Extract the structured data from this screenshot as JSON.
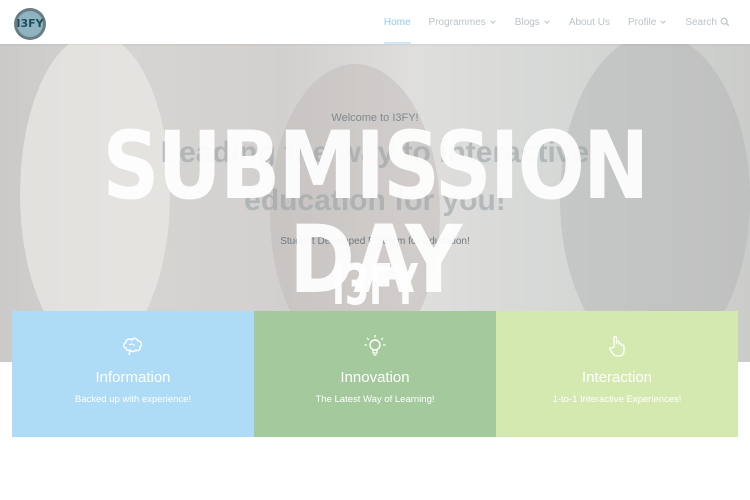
{
  "logo": {
    "text": "I3FY"
  },
  "nav": {
    "items": [
      {
        "label": "Home",
        "active": true,
        "dropdown": false
      },
      {
        "label": "Programmes",
        "active": false,
        "dropdown": true
      },
      {
        "label": "Blogs",
        "active": false,
        "dropdown": true
      },
      {
        "label": "About Us",
        "active": false,
        "dropdown": false
      },
      {
        "label": "Profile",
        "active": false,
        "dropdown": true
      }
    ],
    "search_label": "Search"
  },
  "hero": {
    "welcome": "Welcome to I3FY!",
    "headline_lines": [
      "Leading the way to interactive",
      "education for you!"
    ],
    "subtext": "Student Developed Platform for Education!",
    "overlay_title": "SUBMISSION DAY",
    "overlay_subtitle": "I3FY"
  },
  "features": [
    {
      "icon": "brain-icon",
      "title": "Information",
      "description": "Backed up with experience!",
      "color": "#aedbf6"
    },
    {
      "icon": "lightbulb-icon",
      "title": "Innovation",
      "description": "The Latest Way of Learning!",
      "color": "#a3c99c"
    },
    {
      "icon": "hand-pointer-icon",
      "title": "Interaction",
      "description": "1-to-1 Interactive Experiences!",
      "color": "#d4e9b0"
    }
  ],
  "colors": {
    "nav_active": "#8ecbf0",
    "nav_text": "#b9c3c8"
  }
}
